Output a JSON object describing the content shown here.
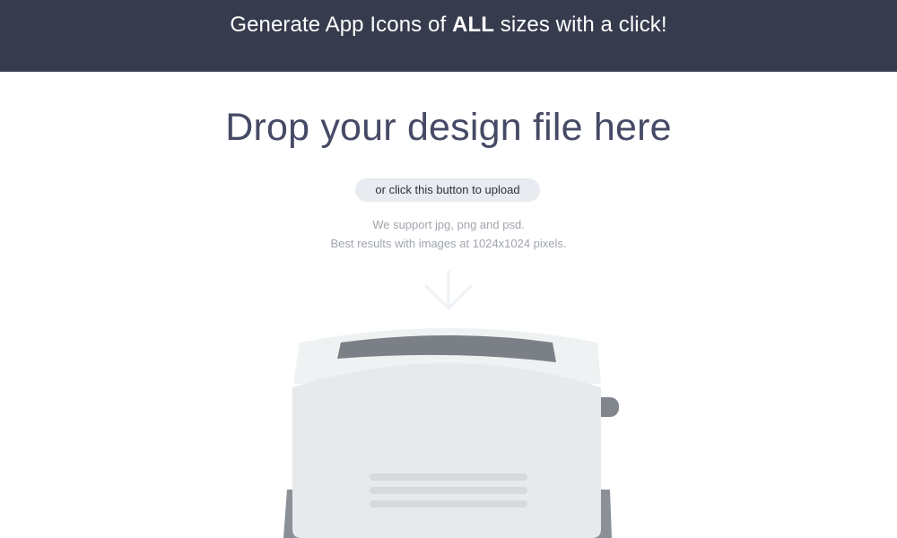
{
  "banner": {
    "prefix": "Generate App Icons of ",
    "emphasis": "ALL",
    "suffix": " sizes with a click!"
  },
  "main": {
    "title": "Drop your design file here",
    "upload_button_label": "or click this button to upload",
    "support_line_1": "We support jpg, png and psd.",
    "support_line_2": "Best results with images at 1024x1024 pixels."
  },
  "colors": {
    "banner_background": "#363b4d",
    "title_text": "#464a66",
    "button_background": "#e8ebef",
    "support_text": "#a0a5ad",
    "toaster_body": "#e6eaed",
    "toaster_top": "#eef2f3",
    "toaster_slot": "#7a8085"
  },
  "icons": {
    "drop_arrow": "down-arrow-icon",
    "illustration": "toaster-illustration"
  }
}
